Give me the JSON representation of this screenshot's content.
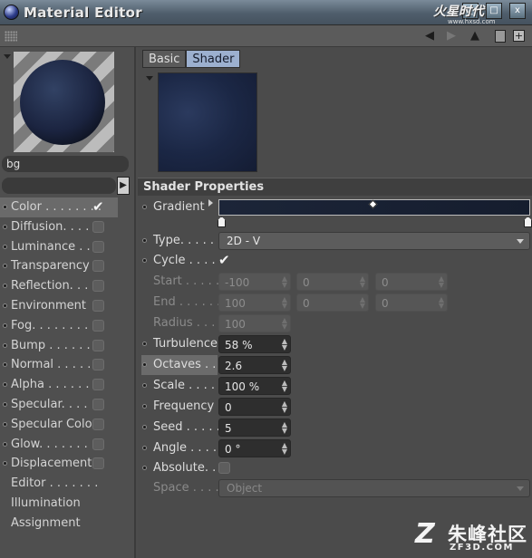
{
  "window": {
    "title": "Material Editor"
  },
  "watermark_top": {
    "brand": "火星时代",
    "site": "www.hxsd.com"
  },
  "material": {
    "name": "bg"
  },
  "channels": [
    {
      "label": "Color . . . . . . . .",
      "checked": true,
      "active": true
    },
    {
      "label": "Diffusion. . . . .",
      "checked": false
    },
    {
      "label": "Luminance . . . .",
      "checked": false
    },
    {
      "label": "Transparency",
      "checked": false
    },
    {
      "label": "Reflection. . . .",
      "checked": false
    },
    {
      "label": "Environment",
      "checked": false
    },
    {
      "label": "Fog. . . . . . . . .",
      "checked": false
    },
    {
      "label": "Bump . . . . . . .",
      "checked": false
    },
    {
      "label": "Normal . . . . . .",
      "checked": false
    },
    {
      "label": "Alpha . . . . . . .",
      "checked": false
    },
    {
      "label": "Specular. . . . .",
      "checked": false
    },
    {
      "label": "Specular Color",
      "checked": false
    },
    {
      "label": "Glow. . . . . . . .",
      "checked": false
    },
    {
      "label": "Displacement",
      "checked": false
    },
    {
      "label": "Editor . . . . . . ."
    },
    {
      "label": "Illumination"
    },
    {
      "label": "Assignment"
    }
  ],
  "tabs": [
    {
      "label": "Basic",
      "selected": false
    },
    {
      "label": "Shader",
      "selected": true
    }
  ],
  "section": {
    "title": "Shader Properties"
  },
  "props": {
    "gradient": {
      "label": "Gradient"
    },
    "type": {
      "label": "Type. . . . .",
      "value": "2D - V"
    },
    "cycle": {
      "label": "Cycle . . . .",
      "checked": true
    },
    "start": {
      "label": "Start . . . . .",
      "v1": "-100",
      "v2": "0",
      "v3": "0"
    },
    "end": {
      "label": "End . . . . . .",
      "v1": "100",
      "v2": "0",
      "v3": "0"
    },
    "radius": {
      "label": "Radius . . .",
      "value": "100"
    },
    "turbulence": {
      "label": "Turbulence",
      "value": "58 %"
    },
    "octaves": {
      "label": "Octaves . . .",
      "value": "2.6"
    },
    "scale": {
      "label": "Scale . . . .",
      "value": "100 %"
    },
    "frequency": {
      "label": "Frequency",
      "value": "0"
    },
    "seed": {
      "label": "Seed . . . . .",
      "value": "5"
    },
    "angle": {
      "label": "Angle . . . .",
      "value": "0 °"
    },
    "absolute": {
      "label": "Absolute. .",
      "checked": false
    },
    "space": {
      "label": "Space . . . .",
      "value": "Object"
    }
  },
  "watermark_bottom": {
    "brand": "朱峰社区",
    "site": "ZF3D.COM"
  },
  "colors": {
    "tab_selected": "#9cb0cf",
    "gradient_dark": "#1c2538"
  }
}
